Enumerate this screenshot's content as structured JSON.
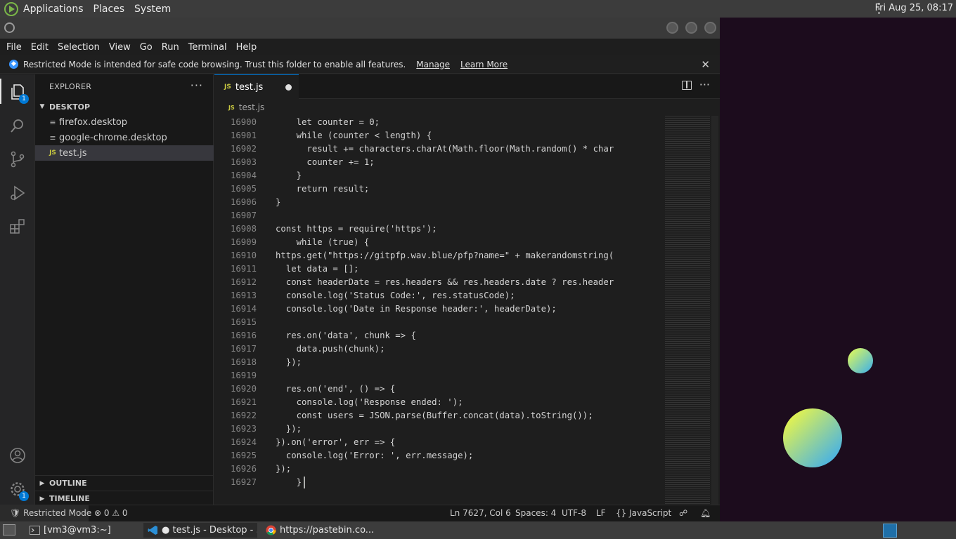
{
  "topbar": {
    "menus": [
      "Applications",
      "Places",
      "System"
    ],
    "clock": "Fri Aug 25, 08:17"
  },
  "menubar": [
    "File",
    "Edit",
    "Selection",
    "View",
    "Go",
    "Run",
    "Terminal",
    "Help"
  ],
  "notice": {
    "text": "Restricted Mode is intended for safe code browsing. Trust this folder to enable all features.",
    "manage": "Manage",
    "learn_more": "Learn More"
  },
  "activity": {
    "explorer_badge": "1",
    "manage_badge": "1"
  },
  "sidebar": {
    "title": "EXPLORER",
    "folder": "DESKTOP",
    "files": [
      "firefox.desktop",
      "google-chrome.desktop",
      "test.js"
    ],
    "outline": "OUTLINE",
    "timeline": "TIMELINE"
  },
  "editor": {
    "tab_label": "test.js",
    "tab_icon": "JS",
    "breadcrumb": "test.js",
    "lines": [
      {
        "n": "16900",
        "t": "    let counter = 0;"
      },
      {
        "n": "16901",
        "t": "    while (counter < length) {"
      },
      {
        "n": "16902",
        "t": "      result += characters.charAt(Math.floor(Math.random() * char"
      },
      {
        "n": "16903",
        "t": "      counter += 1;"
      },
      {
        "n": "16904",
        "t": "    }"
      },
      {
        "n": "16905",
        "t": "    return result;"
      },
      {
        "n": "16906",
        "t": "}"
      },
      {
        "n": "16907",
        "t": ""
      },
      {
        "n": "16908",
        "t": "const https = require('https');"
      },
      {
        "n": "16909",
        "t": "    while (true) {"
      },
      {
        "n": "16910",
        "t": "https.get(\"https://gitpfp.wav.blue/pfp?name=\" + makerandomstring("
      },
      {
        "n": "16911",
        "t": "  let data = [];"
      },
      {
        "n": "16912",
        "t": "  const headerDate = res.headers && res.headers.date ? res.header"
      },
      {
        "n": "16913",
        "t": "  console.log('Status Code:', res.statusCode);"
      },
      {
        "n": "16914",
        "t": "  console.log('Date in Response header:', headerDate);"
      },
      {
        "n": "16915",
        "t": ""
      },
      {
        "n": "16916",
        "t": "  res.on('data', chunk => {"
      },
      {
        "n": "16917",
        "t": "    data.push(chunk);"
      },
      {
        "n": "16918",
        "t": "  });"
      },
      {
        "n": "16919",
        "t": ""
      },
      {
        "n": "16920",
        "t": "  res.on('end', () => {"
      },
      {
        "n": "16921",
        "t": "    console.log('Response ended: ');"
      },
      {
        "n": "16922",
        "t": "    const users = JSON.parse(Buffer.concat(data).toString());"
      },
      {
        "n": "16923",
        "t": "  });"
      },
      {
        "n": "16924",
        "t": "}).on('error', err => {"
      },
      {
        "n": "16925",
        "t": "  console.log('Error: ', err.message);"
      },
      {
        "n": "16926",
        "t": "});"
      },
      {
        "n": "16927",
        "t": "    }"
      }
    ]
  },
  "statusbar": {
    "restricted": "Restricted Mode",
    "errors": "0",
    "warnings": "0",
    "position": "Ln 7627, Col 6",
    "spaces": "Spaces: 4",
    "encoding": "UTF-8",
    "eol": "LF",
    "language": "JavaScript"
  },
  "taskbar": {
    "items": [
      "[vm3@vm3:~]",
      "test.js - Desktop - ...",
      "https://pastebin.co..."
    ]
  }
}
